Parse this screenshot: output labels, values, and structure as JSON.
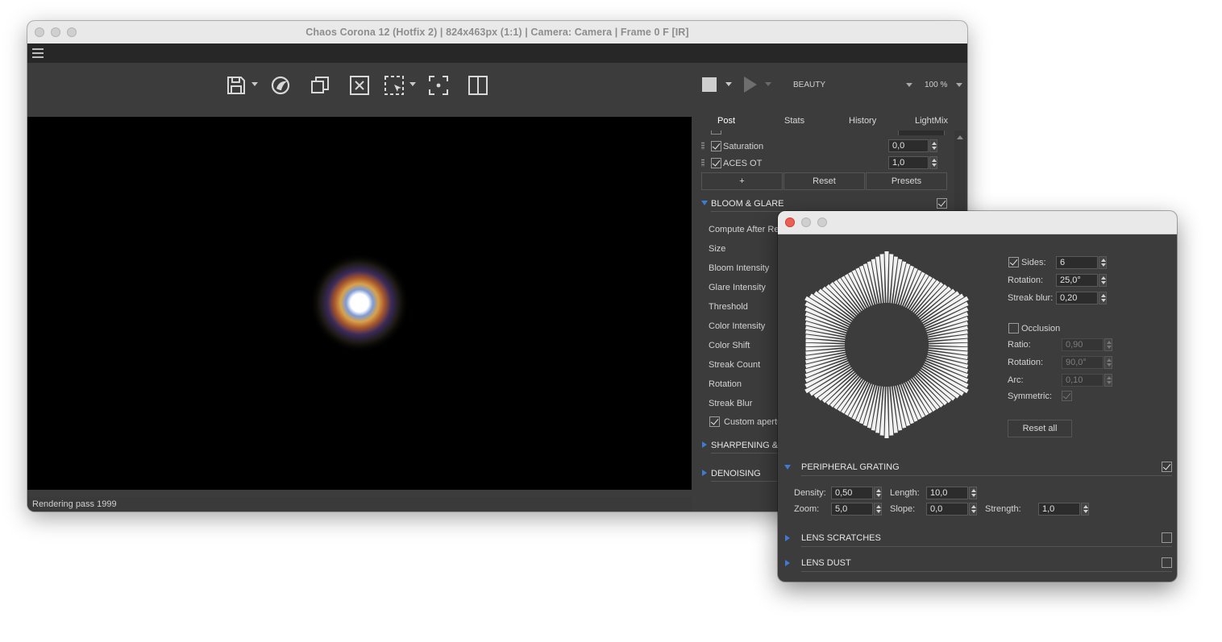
{
  "window": {
    "title": "Chaos Corona 12 (Hotfix 2) | 824x463px (1:1) | Camera: Camera | Frame 0 F [IR]"
  },
  "toolbar": {
    "icons": [
      "save-icon",
      "corona-logo-icon",
      "copy-icon",
      "clear-icon",
      "region-select-icon",
      "focus-icon",
      "compare-icon",
      "stop-icon",
      "play-icon"
    ],
    "channel": "BEAUTY",
    "zoom": "100 %"
  },
  "status": {
    "text": "Rendering pass 1999"
  },
  "tabs": [
    "Post",
    "Stats",
    "History",
    "LightMix"
  ],
  "post": {
    "rows": [
      {
        "label": "Saturation",
        "value": "0,0",
        "checked": true
      },
      {
        "label": "ACES OT",
        "value": "1,0",
        "checked": true
      }
    ],
    "buttons": {
      "add": "+",
      "reset": "Reset",
      "presets": "Presets"
    },
    "bloom": {
      "title": "BLOOM & GLARE",
      "enabled": true,
      "labels": [
        "Compute After Re",
        "Size",
        "Bloom Intensity",
        "Glare Intensity",
        "Threshold",
        "Color Intensity",
        "Color Shift",
        "Streak Count",
        "Rotation",
        "Streak Blur"
      ],
      "custom_aperture": "Custom apertu"
    },
    "sharpening_title": "SHARPENING & B",
    "denoising_title": "DENOISING"
  },
  "aperture": {
    "sides_label": "Sides:",
    "sides": "6",
    "sides_checked": true,
    "rotation_label": "Rotation:",
    "rotation": "25,0°",
    "streak_blur_label": "Streak blur:",
    "streak_blur": "0,20",
    "occlusion_label": "Occlusion",
    "occlusion_checked": false,
    "ratio_label": "Ratio:",
    "ratio": "0,90",
    "occ_rotation_label": "Rotation:",
    "occ_rotation": "90,0°",
    "arc_label": "Arc:",
    "arc": "0,10",
    "symmetric_label": "Symmetric:",
    "symmetric_checked": true,
    "reset_all": "Reset all"
  },
  "grating": {
    "title": "PERIPHERAL GRATING",
    "enabled": true,
    "density_label": "Density:",
    "density": "0,50",
    "length_label": "Length:",
    "length": "10,0",
    "zoom_label": "Zoom:",
    "zoom": "5,0",
    "slope_label": "Slope:",
    "slope": "0,0",
    "strength_label": "Strength:",
    "strength": "1,0"
  },
  "scratches": {
    "title": "LENS SCRATCHES",
    "enabled": false
  },
  "dust": {
    "title": "LENS DUST",
    "enabled": false
  },
  "colors": {
    "accent": "#3d7bd6",
    "panel": "#3c3c3c",
    "viewport": "#000000"
  }
}
